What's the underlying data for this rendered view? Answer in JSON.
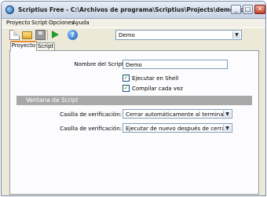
{
  "window": {
    "title": "Scriptius Free - C:\\Archivos de programa\\Scriptius\\Projects\\demo.sp",
    "buttons": {
      "minimize": "_",
      "maximize": "□",
      "close": "✕"
    }
  },
  "menu": [
    "Proyecto",
    "Script",
    "Opciones",
    "Ayuda"
  ],
  "toolbar": {
    "icons": [
      "new-file-icon",
      "open-folder-icon",
      "save-icon",
      "run-icon",
      "help-icon"
    ],
    "help_glyph": "?",
    "script_select": {
      "value": "Demo"
    }
  },
  "tabs": [
    {
      "label": "Proyecto",
      "active": true
    },
    {
      "label": "Script",
      "active": false
    }
  ],
  "form": {
    "script_name_label": "Nombre del Script:",
    "script_name_value": "Demo",
    "run_in_shell_label": "Ejecutar en Shell",
    "run_in_shell_checked": true,
    "compile_each_time_label": "Compilar cada vez",
    "compile_each_time_checked": true,
    "section_title": "Ventana de Script",
    "check1_label": "Casilla de verificación:",
    "check1_value": "Cerrar automáticamente al terminar",
    "check2_label": "Casilla de verificación:",
    "check2_value": "Ejecutar de nuevo después de cerrar"
  },
  "colors": {
    "active_tab_accent": "#e68b2c",
    "section_header": "#a8a8a8",
    "check_mark": "#21a121"
  }
}
